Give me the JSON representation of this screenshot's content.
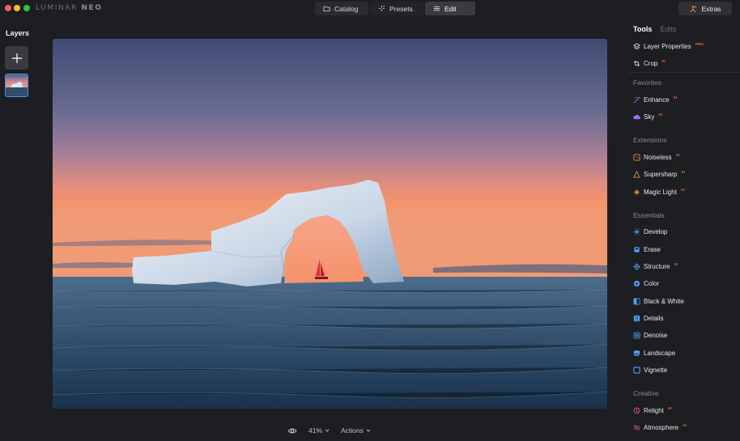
{
  "app": {
    "brand_light": "LUMINAR ",
    "brand_bold": "NEO"
  },
  "topnav": {
    "tabs": [
      {
        "label": "Catalog",
        "icon": "folder-icon"
      },
      {
        "label": "Presets",
        "icon": "sparkle-icon"
      },
      {
        "label": "Edit",
        "icon": "sliders-icon",
        "active": true
      }
    ],
    "extras_label": "Extras"
  },
  "layers": {
    "title": "Layers"
  },
  "bottombar": {
    "zoom": "41%",
    "actions": "Actions"
  },
  "panel": {
    "tabs": [
      {
        "label": "Tools",
        "active": true
      },
      {
        "label": "Edits",
        "active": false
      }
    ],
    "tools_top": [
      {
        "label": "Layer Properties",
        "tag": "PRO",
        "icon": "layers-icon"
      },
      {
        "label": "Crop",
        "tag": "AI",
        "icon": "crop-icon"
      }
    ],
    "sections": [
      {
        "title": "Favorites",
        "items": [
          {
            "label": "Enhance",
            "tag": "AI",
            "icon": "enhance-icon"
          },
          {
            "label": "Sky",
            "tag": "AI",
            "icon": "cloud-icon"
          }
        ]
      },
      {
        "title": "Extensions",
        "items": [
          {
            "label": "Noiseless",
            "tag": "AI",
            "icon": "noiseless-icon"
          },
          {
            "label": "Supersharp",
            "tag": "AI",
            "icon": "supersharp-icon"
          },
          {
            "label": "Magic Light",
            "tag": "AI",
            "icon": "magic-light-icon"
          }
        ]
      },
      {
        "title": "Essentials",
        "items": [
          {
            "label": "Develop",
            "tag": "",
            "icon": "sun-icon"
          },
          {
            "label": "Erase",
            "tag": "",
            "icon": "erase-icon"
          },
          {
            "label": "Structure",
            "tag": "AI",
            "icon": "structure-icon"
          },
          {
            "label": "Color",
            "tag": "",
            "icon": "color-icon"
          },
          {
            "label": "Black & White",
            "tag": "",
            "icon": "bw-icon"
          },
          {
            "label": "Details",
            "tag": "",
            "icon": "details-icon"
          },
          {
            "label": "Denoise",
            "tag": "",
            "icon": "denoise-icon"
          },
          {
            "label": "Landscape",
            "tag": "",
            "icon": "landscape-icon"
          },
          {
            "label": "Vignette",
            "tag": "",
            "icon": "vignette-icon"
          }
        ]
      },
      {
        "title": "Creative",
        "items": [
          {
            "label": "Relight",
            "tag": "AI",
            "icon": "relight-icon"
          },
          {
            "label": "Atmosphere",
            "tag": "AI",
            "icon": "atmosphere-icon"
          }
        ]
      }
    ]
  },
  "colors": {
    "accent_tag": "#ff6a3d",
    "selection": "#4a90e2",
    "background": "#1d1e21"
  }
}
